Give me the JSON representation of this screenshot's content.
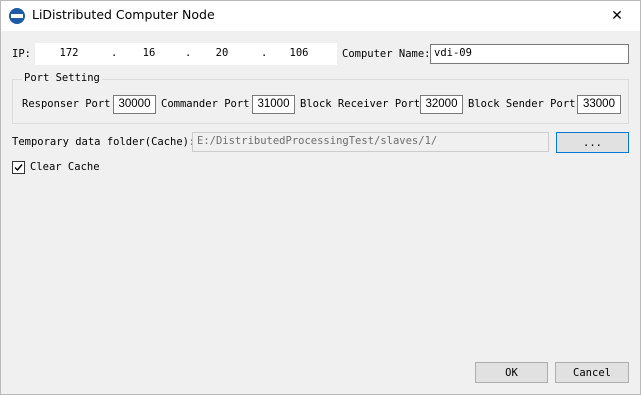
{
  "window": {
    "title": "LiDistributed Computer Node",
    "close_glyph": "✕"
  },
  "ip": {
    "label": "IP:",
    "octets": [
      "172",
      "16",
      "20",
      "106"
    ],
    "separator": "."
  },
  "computer_name": {
    "label": "Computer Name:",
    "value": "vdi-09"
  },
  "port_setting": {
    "title": "Port Setting",
    "responser": {
      "label": "Responser Port",
      "value": "30000"
    },
    "commander": {
      "label": "Commander Port",
      "value": "31000"
    },
    "block_receiver": {
      "label": "Block Receiver Port",
      "value": "32000"
    },
    "block_sender": {
      "label": "Block Sender Port",
      "value": "33000"
    }
  },
  "cache": {
    "label": "Temporary data folder(Cache):",
    "path": "E:/DistributedProcessingTest/slaves/1/",
    "browse_label": "...",
    "clear_label": "Clear Cache",
    "clear_checked": true
  },
  "buttons": {
    "ok": "OK",
    "cancel": "Cancel"
  },
  "colors": {
    "window_bg": "#f0f0f0",
    "accent": "#0078d7",
    "app_icon": "#1c5aa8"
  }
}
